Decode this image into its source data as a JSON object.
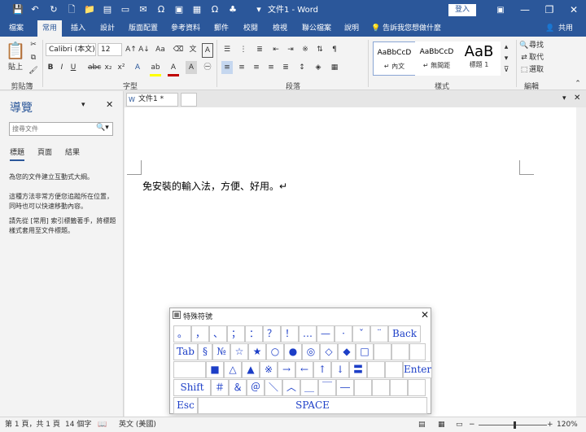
{
  "titlebar": {
    "doc_title": "文件1 - Word",
    "signin": "登入",
    "minimize": "—",
    "restore": "❐",
    "close": "✕",
    "qa_save": "💾",
    "qa_undo": "↶",
    "qa_redo": "↻",
    "qa_new": "🗋",
    "qa_open": "📁",
    "qa_more": "▾"
  },
  "menu": {
    "tabs": [
      "檔案",
      "常用",
      "插入",
      "設計",
      "版面配置",
      "參考資料",
      "郵件",
      "校閱",
      "檢視",
      "聯公檔案",
      "說明"
    ],
    "active_index": 1,
    "tell_me": "告訴我您想做什麼",
    "share": "共用"
  },
  "ribbon": {
    "paste": "貼上",
    "clipboard_label": "剪貼簿",
    "font_name": "Calibri (本文)",
    "font_size": "12",
    "font_label": "字型",
    "paragraph_label": "段落",
    "styles_label": "樣式",
    "editing_label": "編輯",
    "bold": "B",
    "italic": "I",
    "underline": "U",
    "strike": "abc",
    "subscript": "x₂",
    "superscript": "x²",
    "grow": "A↑",
    "shrink": "A↓",
    "case": "Aa",
    "find": "尋找",
    "replace": "取代",
    "select": "選取",
    "styles": [
      {
        "sample": "AaBbCcD",
        "name": "↵ 內文"
      },
      {
        "sample": "AaBbCcD",
        "name": "↵ 無間距"
      },
      {
        "sample": "AaB",
        "name": "標題 1"
      }
    ]
  },
  "nav": {
    "title": "導覽",
    "search_placeholder": "搜尋文件",
    "tabs": [
      "標題",
      "頁面",
      "結果"
    ],
    "text1": "為您的文件建立互動式大綱。",
    "text2": "這種方法非常方便您追蹤所在位置，同時也可以快速移動內容。",
    "text3": "請先從 [常用] 索引標籤著手，將標題樣式套用至文件標題。"
  },
  "document": {
    "tab_label": "文件1 *",
    "body_text": "免安裝的輸入法，方便、好用。↵"
  },
  "status": {
    "page": "第 1 頁，共 1 頁",
    "words": "14 個字",
    "language": "英文 (美國)",
    "zoom": "120%",
    "zoom_level": 1.2
  },
  "keyboard": {
    "title": "特殊符號",
    "close": "✕",
    "rows": [
      [
        "。",
        "，",
        "、",
        "；",
        "：",
        "？",
        "！",
        "…",
        "—",
        "·",
        "ˇ",
        "¨",
        "Back"
      ],
      [
        "Tab",
        "§",
        "№",
        "☆",
        "★",
        "○",
        "●",
        "◎",
        "◇",
        "◆",
        "□",
        "",
        "",
        ""
      ],
      [
        "",
        "■",
        "△",
        "▲",
        "※",
        "→",
        "←",
        "↑",
        "↓",
        "〓",
        "",
        "",
        "Enter"
      ],
      [
        "Shift",
        "＃",
        "＆",
        "＠",
        "＼",
        "︿",
        "＿",
        "￣",
        "―",
        "",
        "",
        "",
        ""
      ],
      [
        "Esc",
        "SPACE"
      ]
    ]
  }
}
